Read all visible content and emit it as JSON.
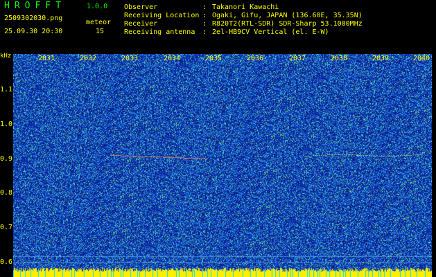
{
  "header": {
    "app_name": "HROFFT",
    "version": "1.0.0",
    "filename": "2509302030.png",
    "datetime": "25.09.30 20:30",
    "meteor_label": "meteor",
    "meteor_count": "15"
  },
  "info": [
    {
      "label": "Observer",
      "value": "Takanori Kawachi"
    },
    {
      "label": "Receiving Location",
      "value": "Ogaki, Gifu, JAPAN (136.60E, 35.35N)"
    },
    {
      "label": "Receiver",
      "value": "R820T2(RTL-SDR) SDR-Sharp 53.1000MHz"
    },
    {
      "label": "Receiving antenna",
      "value": "2el-HB9CV Vertical (el. E-W)"
    }
  ],
  "axes": {
    "y_unit": "kHz",
    "x_ticks": [
      "2031",
      "2032",
      "2033",
      "2034",
      "2035",
      "2036",
      "2037",
      "2038",
      "2039",
      "2040"
    ],
    "y_ticks": [
      "1.1",
      "1.0",
      "0.9",
      "0.8",
      "0.7",
      "0.6"
    ]
  },
  "colors": {
    "text_yellow": "#ffff00",
    "text_green": "#00ff00",
    "background": "#0b2a8e"
  }
}
